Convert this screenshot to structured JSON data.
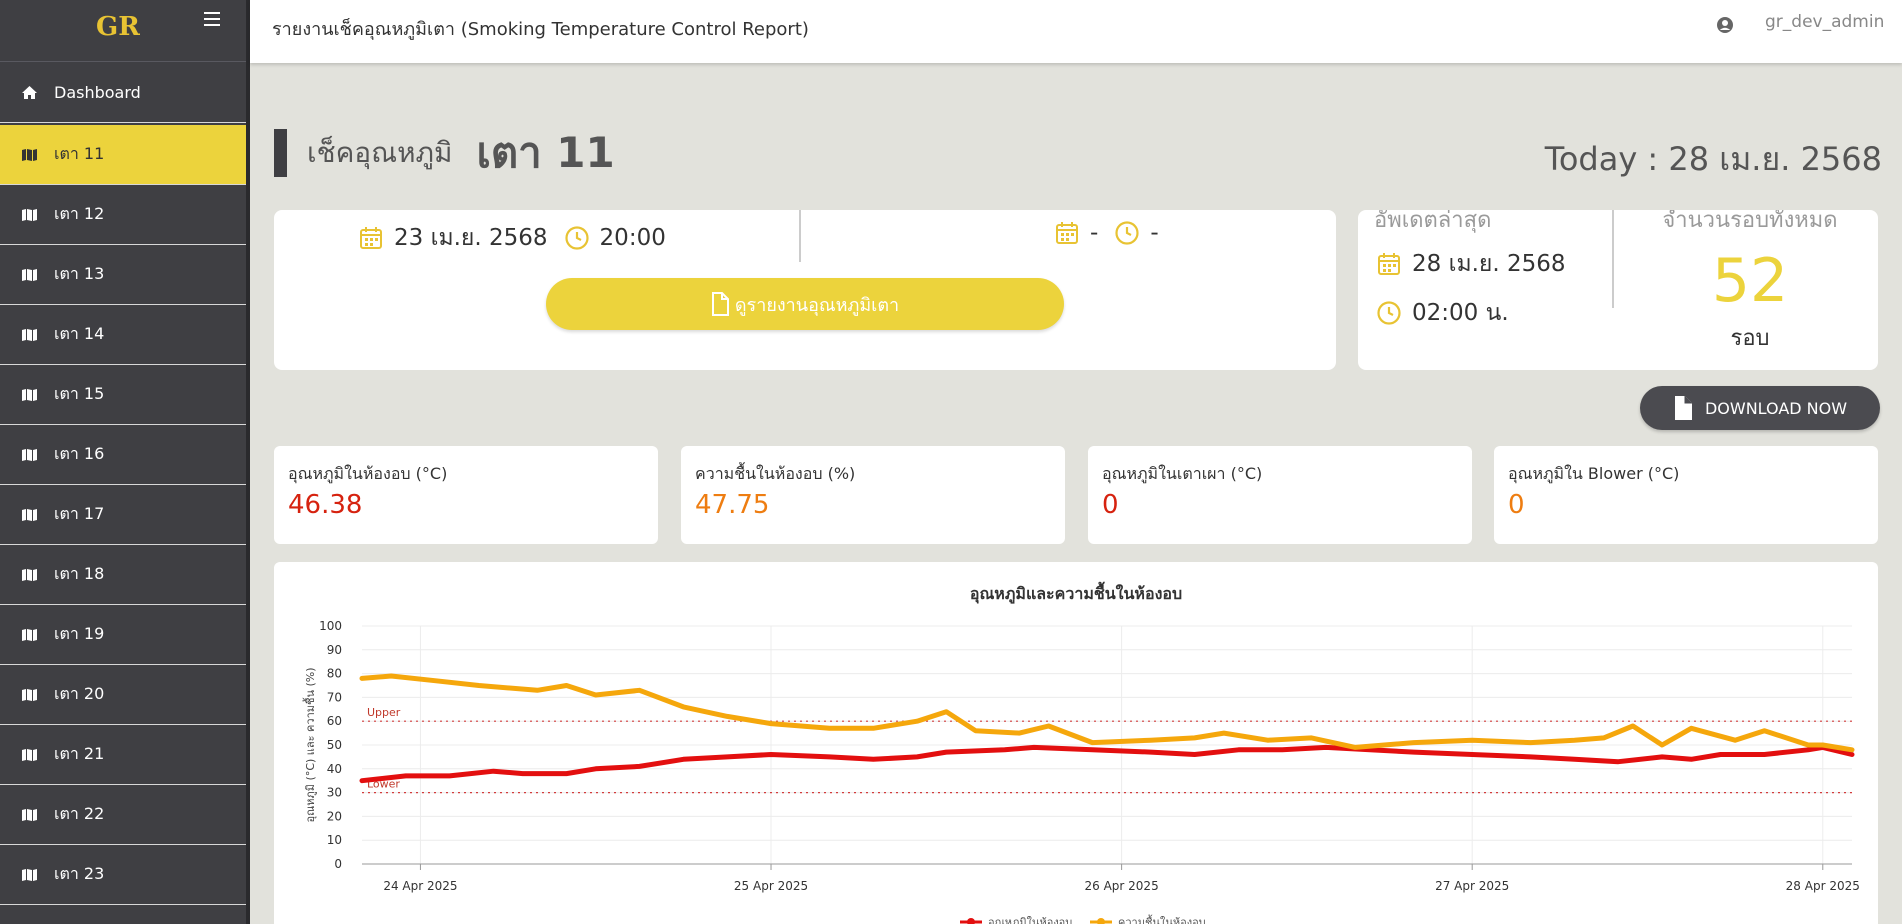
{
  "brand": {
    "logo": "GR"
  },
  "sidebar": {
    "dashboard_label": "Dashboard",
    "items": [
      {
        "label": "เตา 11",
        "active": true
      },
      {
        "label": "เตา 12"
      },
      {
        "label": "เตา 13"
      },
      {
        "label": "เตา 14"
      },
      {
        "label": "เตา 15"
      },
      {
        "label": "เตา 16"
      },
      {
        "label": "เตา 17"
      },
      {
        "label": "เตา 18"
      },
      {
        "label": "เตา 19"
      },
      {
        "label": "เตา 20"
      },
      {
        "label": "เตา 21"
      },
      {
        "label": "เตา 22"
      },
      {
        "label": "เตา 23"
      }
    ]
  },
  "topbar": {
    "title": "รายงานเช็คอุณหภูมิเตา (Smoking Temperature Control Report)",
    "username": "gr_dev_admin"
  },
  "header": {
    "subtitle": "เช็คอุณหภูมิ",
    "oven": "เตา 11",
    "today": "Today : 28 เม.ย. 2568"
  },
  "info": {
    "start_date": "23 เม.ย. 2568",
    "start_time": "20:00",
    "end_date": "-",
    "end_time": "-",
    "report_button": "ดูรายงานอุณหภูมิเตา"
  },
  "update": {
    "label": "อัพเดตล่าสุด",
    "date": "28 เม.ย. 2568",
    "time": "02:00 น.",
    "cycle_label": "จำนวนรอบทั้งหมด",
    "cycle_count": "52",
    "cycle_unit": "รอบ"
  },
  "download_button": "DOWNLOAD NOW",
  "stats": [
    {
      "label": "อุณหภูมิในห้องอบ (°C)",
      "value": "46.38",
      "color": "#d6220f"
    },
    {
      "label": "ความชื้นในห้องอบ (%)",
      "value": "47.75",
      "color": "#ee7d11"
    },
    {
      "label": "อุณหภูมิในเตาเผา (°C)",
      "value": "0",
      "color": "#d6220f"
    },
    {
      "label": "อุณหภูมิใน Blower (°C)",
      "value": "0",
      "color": "#ee7d11"
    }
  ],
  "colors": {
    "accent": "#ecd33c",
    "sidebar": "#3f3f43",
    "temp_line": "#e30f0f",
    "humidity_line": "#f5a70c",
    "limit_line": "#d23c3c"
  },
  "chart_data": {
    "type": "line",
    "title": "อุณหภูมิและความชื้นในห้องอบ",
    "ylabel": "อุณหภูมิ (°C) และ ความชื้น (%)",
    "xlabel": "",
    "ylim": [
      0,
      100
    ],
    "yticks": [
      0,
      10,
      20,
      30,
      40,
      50,
      60,
      70,
      80,
      90,
      100
    ],
    "xlim": [
      "2025-04-23 20:00",
      "2025-04-28 02:00"
    ],
    "xticks": [
      {
        "x": "2025-04-24 00:00",
        "label": "24 Apr 2025"
      },
      {
        "x": "2025-04-25 00:00",
        "label": "25 Apr 2025"
      },
      {
        "x": "2025-04-26 00:00",
        "label": "26 Apr 2025"
      },
      {
        "x": "2025-04-27 00:00",
        "label": "27 Apr 2025"
      },
      {
        "x": "2025-04-28 00:00",
        "label": "28 Apr 2025"
      }
    ],
    "limits": [
      {
        "label": "Upper",
        "value": 60
      },
      {
        "label": "Lower",
        "value": 30
      }
    ],
    "grid": true,
    "series": [
      {
        "name": "อุณหภูมิในห้องอบ",
        "points": [
          [
            "2025-04-23 20:00",
            35
          ],
          [
            "2025-04-23 23:00",
            37
          ],
          [
            "2025-04-24 02:00",
            37
          ],
          [
            "2025-04-24 05:00",
            39
          ],
          [
            "2025-04-24 07:00",
            38
          ],
          [
            "2025-04-24 10:00",
            38
          ],
          [
            "2025-04-24 12:00",
            40
          ],
          [
            "2025-04-24 15:00",
            41
          ],
          [
            "2025-04-24 18:00",
            44
          ],
          [
            "2025-04-24 21:00",
            45
          ],
          [
            "2025-04-25 00:00",
            46
          ],
          [
            "2025-04-25 04:00",
            45
          ],
          [
            "2025-04-25 07:00",
            44
          ],
          [
            "2025-04-25 10:00",
            45
          ],
          [
            "2025-04-25 12:00",
            47
          ],
          [
            "2025-04-25 16:00",
            48
          ],
          [
            "2025-04-25 18:00",
            49
          ],
          [
            "2025-04-25 22:00",
            48
          ],
          [
            "2025-04-26 02:00",
            47
          ],
          [
            "2025-04-26 05:00",
            46
          ],
          [
            "2025-04-26 08:00",
            48
          ],
          [
            "2025-04-26 11:00",
            48
          ],
          [
            "2025-04-26 14:00",
            49
          ],
          [
            "2025-04-26 17:00",
            48
          ],
          [
            "2025-04-26 20:00",
            47
          ],
          [
            "2025-04-27 00:00",
            46
          ],
          [
            "2025-04-27 04:00",
            45
          ],
          [
            "2025-04-27 07:00",
            44
          ],
          [
            "2025-04-27 10:00",
            43
          ],
          [
            "2025-04-27 13:00",
            45
          ],
          [
            "2025-04-27 15:00",
            44
          ],
          [
            "2025-04-27 17:00",
            46
          ],
          [
            "2025-04-27 20:00",
            46
          ],
          [
            "2025-04-27 23:00",
            48
          ],
          [
            "2025-04-28 00:00",
            49
          ],
          [
            "2025-04-28 02:00",
            46
          ]
        ]
      },
      {
        "name": "ความชื้นในห้องอบ",
        "points": [
          [
            "2025-04-23 20:00",
            78
          ],
          [
            "2025-04-23 22:00",
            79
          ],
          [
            "2025-04-24 01:00",
            77
          ],
          [
            "2025-04-24 04:00",
            75
          ],
          [
            "2025-04-24 08:00",
            73
          ],
          [
            "2025-04-24 10:00",
            75
          ],
          [
            "2025-04-24 12:00",
            71
          ],
          [
            "2025-04-24 15:00",
            73
          ],
          [
            "2025-04-24 18:00",
            66
          ],
          [
            "2025-04-24 21:00",
            62
          ],
          [
            "2025-04-25 00:00",
            59
          ],
          [
            "2025-04-25 04:00",
            57
          ],
          [
            "2025-04-25 07:00",
            57
          ],
          [
            "2025-04-25 10:00",
            60
          ],
          [
            "2025-04-25 12:00",
            64
          ],
          [
            "2025-04-25 14:00",
            56
          ],
          [
            "2025-04-25 17:00",
            55
          ],
          [
            "2025-04-25 19:00",
            58
          ],
          [
            "2025-04-25 22:00",
            51
          ],
          [
            "2025-04-26 02:00",
            52
          ],
          [
            "2025-04-26 05:00",
            53
          ],
          [
            "2025-04-26 07:00",
            55
          ],
          [
            "2025-04-26 10:00",
            52
          ],
          [
            "2025-04-26 13:00",
            53
          ],
          [
            "2025-04-26 16:00",
            49
          ],
          [
            "2025-04-26 20:00",
            51
          ],
          [
            "2025-04-27 00:00",
            52
          ],
          [
            "2025-04-27 04:00",
            51
          ],
          [
            "2025-04-27 07:00",
            52
          ],
          [
            "2025-04-27 09:00",
            53
          ],
          [
            "2025-04-27 11:00",
            58
          ],
          [
            "2025-04-27 13:00",
            50
          ],
          [
            "2025-04-27 15:00",
            57
          ],
          [
            "2025-04-27 18:00",
            52
          ],
          [
            "2025-04-27 20:00",
            56
          ],
          [
            "2025-04-27 23:00",
            50
          ],
          [
            "2025-04-28 00:00",
            50
          ],
          [
            "2025-04-28 02:00",
            48
          ]
        ]
      }
    ]
  }
}
